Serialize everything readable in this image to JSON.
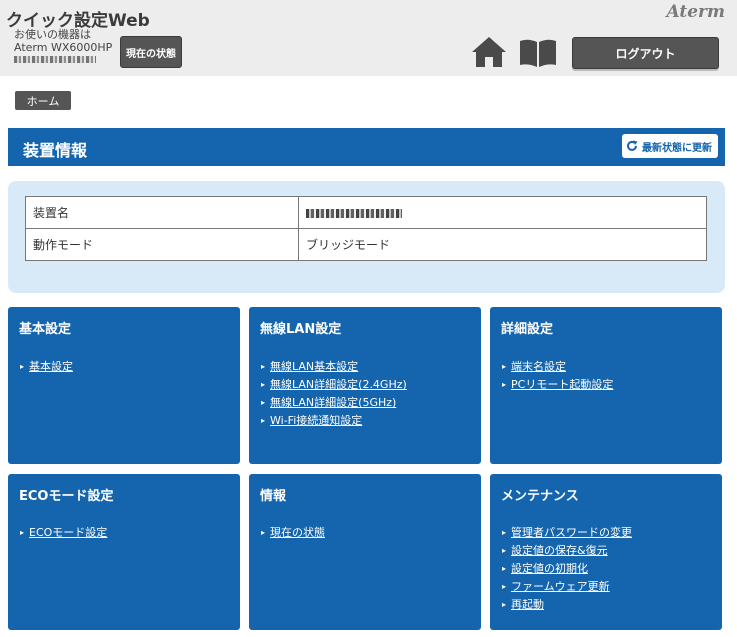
{
  "header": {
    "app_title": "クイック設定Web",
    "device_caption": "お使いの機器は",
    "device_model": "Aterm WX6000HP",
    "status_button": "現在の状態",
    "brand": "Aterm",
    "logout_button": "ログアウト",
    "icons": [
      "home-icon",
      "manual-icon"
    ]
  },
  "breadcrumb": {
    "home": "ホーム"
  },
  "page": {
    "title": "装置情報",
    "refresh_button": "最新状態に更新",
    "refresh_icon": "refresh-icon"
  },
  "info_table": [
    {
      "label": "装置名",
      "value": ""
    },
    {
      "label": "動作モード",
      "value": "ブリッジモード"
    }
  ],
  "cards": [
    {
      "title": "基本設定",
      "links": [
        "基本設定"
      ]
    },
    {
      "title": "無線LAN設定",
      "links": [
        "無線LAN基本設定",
        "無線LAN詳細設定(2.4GHz)",
        "無線LAN詳細設定(5GHz)",
        "Wi-Fi接続通知設定"
      ]
    },
    {
      "title": "詳細設定",
      "links": [
        "端末名設定",
        "PCリモート起動設定"
      ]
    },
    {
      "title": "ECOモード設定",
      "links": [
        "ECOモード設定"
      ]
    },
    {
      "title": "情報",
      "links": [
        "現在の状態"
      ]
    },
    {
      "title": "メンテナンス",
      "links": [
        "管理者パスワードの変更",
        "設定値の保存&復元",
        "設定値の初期化",
        "ファームウェア更新",
        "再起動"
      ]
    }
  ],
  "colors": {
    "accent": "#1465ad",
    "panel": "#d8eaf8",
    "button_dark": "#555555",
    "header_bg": "#ededed"
  }
}
